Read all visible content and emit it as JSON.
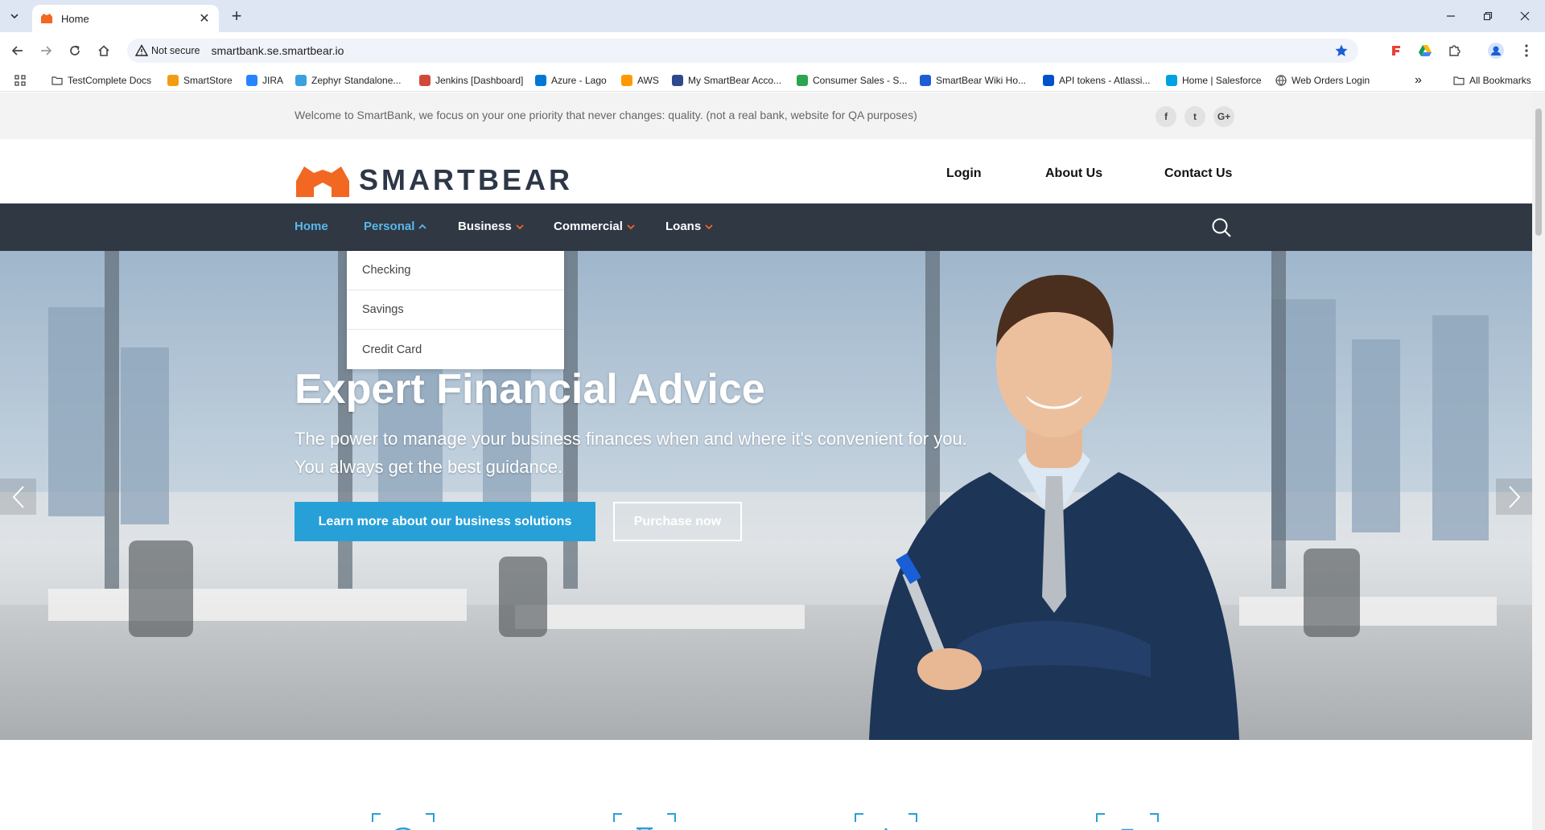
{
  "browser": {
    "tab_title": "Home",
    "security_label": "Not secure",
    "url": "smartbank.se.smartbear.io",
    "bookmarks": [
      {
        "label": "TestComplete Docs",
        "icon": "folder-icon"
      },
      {
        "label": "SmartStore",
        "icon": "smartstore-icon"
      },
      {
        "label": "JIRA",
        "icon": "jira-icon"
      },
      {
        "label": "Zephyr Standalone...",
        "icon": "zephyr-icon"
      },
      {
        "label": "Jenkins [Dashboard]",
        "icon": "jenkins-icon"
      },
      {
        "label": "Azure - Lago",
        "icon": "azure-icon"
      },
      {
        "label": "AWS",
        "icon": "aws-icon"
      },
      {
        "label": "My SmartBear Acco...",
        "icon": "smartbear-icon"
      },
      {
        "label": "Consumer Sales - S...",
        "icon": "consumer-sales-icon"
      },
      {
        "label": "SmartBear Wiki Ho...",
        "icon": "wiki-icon"
      },
      {
        "label": "API tokens - Atlassi...",
        "icon": "atlassian-icon"
      },
      {
        "label": "Home | Salesforce",
        "icon": "salesforce-icon"
      },
      {
        "label": "Web Orders Login",
        "icon": "globe-icon"
      }
    ],
    "more_bookmarks": "»",
    "all_bookmarks": "All Bookmarks"
  },
  "topbar": {
    "welcome": "Welcome to SmartBank, we focus on your one priority that never changes: quality. (not a real bank, website for QA purposes)",
    "social": [
      "f",
      "t",
      "G+"
    ]
  },
  "header": {
    "logo_text": "SMARTBEAR",
    "links": [
      "Login",
      "About Us",
      "Contact Us"
    ]
  },
  "nav": {
    "items": [
      "Home",
      "Personal",
      "Business",
      "Commercial",
      "Loans"
    ],
    "active": "Home",
    "open": "Personal"
  },
  "dropdown": {
    "items": [
      "Checking",
      "Savings",
      "Credit Card"
    ]
  },
  "hero": {
    "title": "Expert Financial Advice",
    "subtitle_line1": "The power to manage your business finances when and where it's convenient for you.",
    "subtitle_line2": "You always get the best guidance.",
    "primary_button": "Learn more about our business solutions",
    "secondary_button": "Purchase now"
  },
  "colors": {
    "nav_bg": "#303844",
    "accent_blue": "#27a0d8",
    "accent_orange": "#f26722"
  }
}
